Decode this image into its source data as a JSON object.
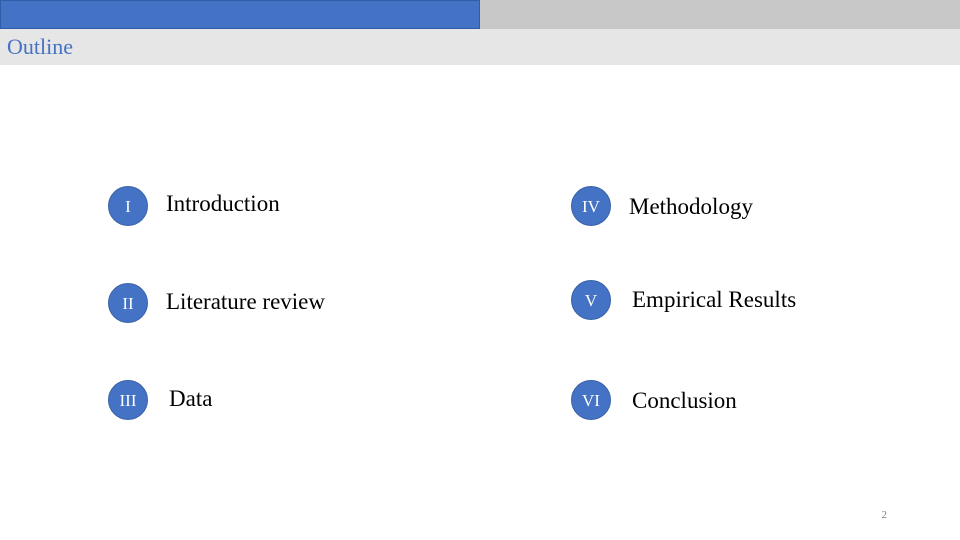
{
  "slide": {
    "title": "Outline",
    "progress": 0.5,
    "page_number": "2"
  },
  "outline": {
    "items": [
      {
        "numeral": "I",
        "label": "Introduction"
      },
      {
        "numeral": "II",
        "label": "Literature review"
      },
      {
        "numeral": "III",
        "label": "Data"
      },
      {
        "numeral": "IV",
        "label": "Methodology"
      },
      {
        "numeral": "V",
        "label": "Empirical Results"
      },
      {
        "numeral": "VI",
        "label": "Conclusion"
      }
    ]
  },
  "colors": {
    "accent": "#4472c4",
    "progress_track": "#c8c8c8",
    "title_bar": "#e6e6e6"
  }
}
